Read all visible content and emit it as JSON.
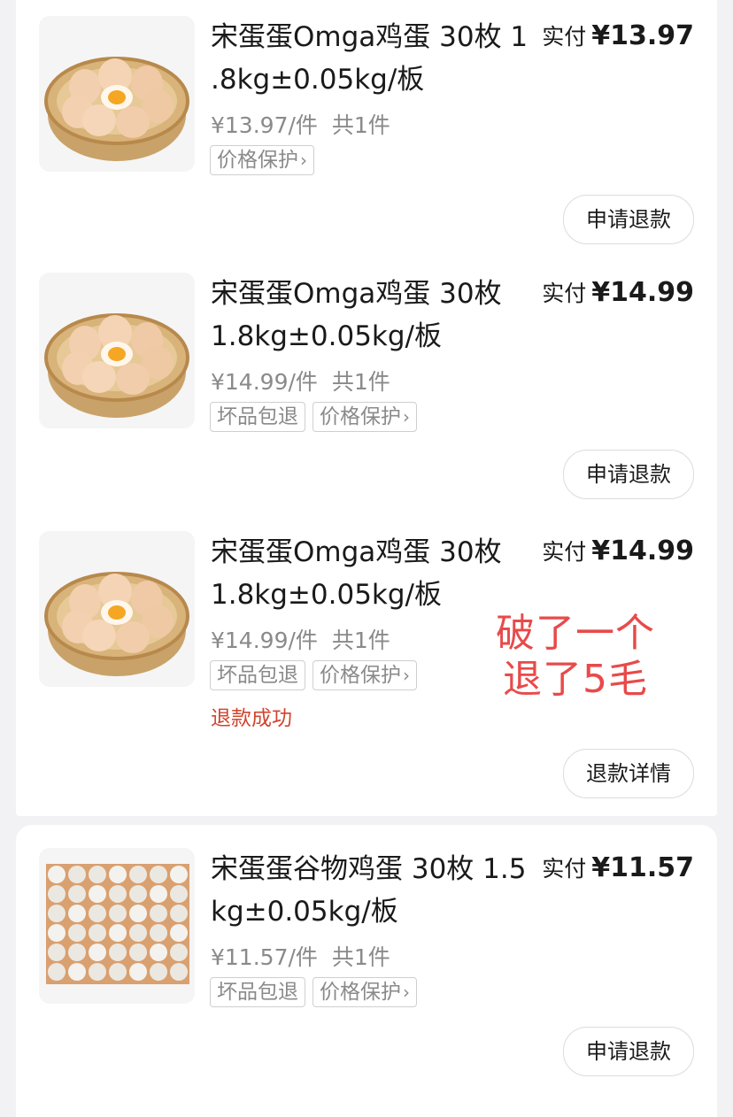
{
  "items": [
    {
      "title_line1": "宋蛋蛋Omga鸡蛋 30枚 1",
      "title_line2": ".8kg±0.05kg/板",
      "pay_label": "实付",
      "pay_amount": "¥13.97",
      "unit_price": "¥13.97/件",
      "quantity": "共1件",
      "tags": [
        "价格保护"
      ],
      "status": "",
      "action": "申请退款"
    },
    {
      "title_line1": "宋蛋蛋Omga鸡蛋 30枚",
      "title_line2": "1.8kg±0.05kg/板",
      "pay_label": "实付",
      "pay_amount": "¥14.99",
      "unit_price": "¥14.99/件",
      "quantity": "共1件",
      "tags": [
        "坏品包退",
        "价格保护"
      ],
      "status": "",
      "action": "申请退款"
    },
    {
      "title_line1": "宋蛋蛋Omga鸡蛋 30枚",
      "title_line2": "1.8kg±0.05kg/板",
      "pay_label": "实付",
      "pay_amount": "¥14.99",
      "unit_price": "¥14.99/件",
      "quantity": "共1件",
      "tags": [
        "坏品包退",
        "价格保护"
      ],
      "status": "退款成功",
      "action": "退款详情"
    },
    {
      "title_line1": "宋蛋蛋谷物鸡蛋 30枚 1.5",
      "title_line2": "kg±0.05kg/板",
      "pay_label": "实付",
      "pay_amount": "¥11.57",
      "unit_price": "¥11.57/件",
      "quantity": "共1件",
      "tags": [
        "坏品包退",
        "价格保护"
      ],
      "status": "",
      "action": "申请退款"
    }
  ],
  "annotation": {
    "line1": "破了一个",
    "line2": "退了5毛"
  },
  "chevron": "›",
  "colors": {
    "status_red": "#d0452f",
    "annotation_red": "#e84a4a",
    "tag_border": "#cfcfcf",
    "muted_text": "#8a8a8a"
  }
}
